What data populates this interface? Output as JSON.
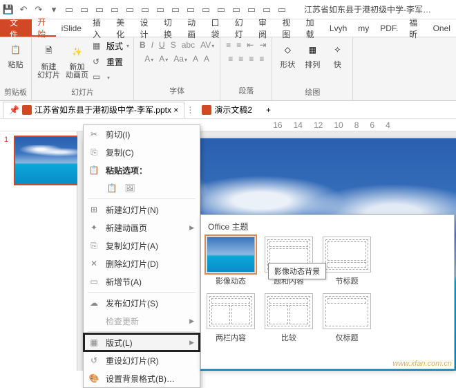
{
  "title": "江苏省如东县于港初级中学-李军…",
  "tabs": {
    "file": "文件",
    "start": "开始",
    "islide": "iSlide",
    "insert": "插入",
    "beautify": "美化",
    "design": "设计",
    "transition": "切换",
    "animation": "动画",
    "pocket": "口袋",
    "slideshow": "幻灯",
    "review": "审阅",
    "view": "视图",
    "addins": "加载",
    "lvyh": "Lvyh",
    "my": "my",
    "pdf": "PDF.",
    "fuxin": "福昕",
    "onel": "Onel"
  },
  "ribbon": {
    "clipboard": {
      "paste": "粘贴",
      "label": "剪贴板"
    },
    "slides": {
      "new": "新建\n幻灯片",
      "anim": "新加\n动画页",
      "layout": "版式",
      "reset": "重置",
      "label": "幻灯片"
    },
    "font": {
      "label": "字体"
    },
    "para": {
      "label": "段落"
    },
    "drawing": {
      "shape": "形状",
      "arrange": "排列",
      "quick": "快",
      "label": "绘图"
    }
  },
  "docTabs": {
    "doc1": "江苏省如东县于港初级中学-李军.pptx ×",
    "doc2": "演示文稿2",
    "add": "+"
  },
  "ruler": [
    "16",
    "14",
    "12",
    "10",
    "8",
    "6",
    "4"
  ],
  "slideNum": "1",
  "ctx": {
    "cut": "剪切(I)",
    "copy": "复制(C)",
    "pasteOpts": "粘贴选项：",
    "newSlide": "新建幻灯片(N)",
    "newAnim": "新建动画页",
    "dupSlide": "复制幻灯片(A)",
    "delSlide": "删除幻灯片(D)",
    "addSection": "新增节(A)",
    "publish": "发布幻灯片(S)",
    "check": "检查更新",
    "layout": "版式(L)",
    "resetSlide": "重设幻灯片(R)",
    "bgFormat": "设置背景格式(B)…"
  },
  "gallery": {
    "title": "Office 主题",
    "items": {
      "sky": "影像动态",
      "titleContent": "题和内容",
      "sectionHeader": "节标题",
      "twoCol": "两栏内容",
      "compare": "比较",
      "titleOnly": "仅标题"
    },
    "tooltip": "影像动态背景"
  },
  "watermark": "www.xfan.com.cn"
}
